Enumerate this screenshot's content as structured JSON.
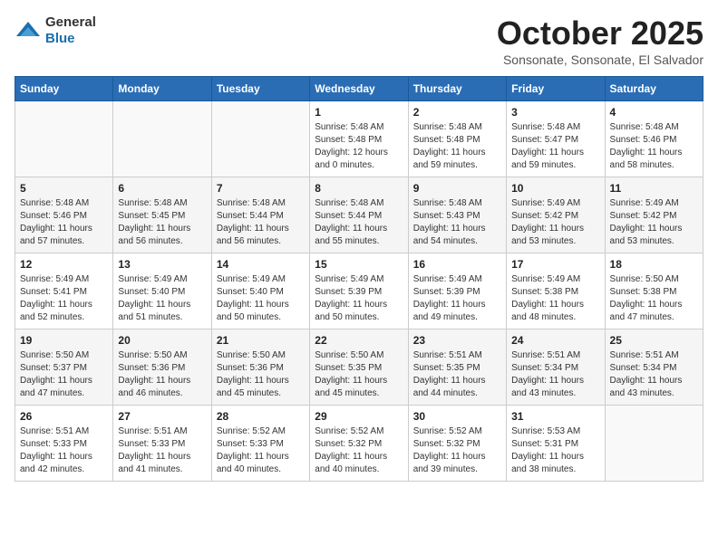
{
  "header": {
    "logo_general": "General",
    "logo_blue": "Blue",
    "month": "October 2025",
    "location": "Sonsonate, Sonsonate, El Salvador"
  },
  "days_of_week": [
    "Sunday",
    "Monday",
    "Tuesday",
    "Wednesday",
    "Thursday",
    "Friday",
    "Saturday"
  ],
  "weeks": [
    [
      {
        "day": "",
        "sunrise": "",
        "sunset": "",
        "daylight": ""
      },
      {
        "day": "",
        "sunrise": "",
        "sunset": "",
        "daylight": ""
      },
      {
        "day": "",
        "sunrise": "",
        "sunset": "",
        "daylight": ""
      },
      {
        "day": "1",
        "sunrise": "Sunrise: 5:48 AM",
        "sunset": "Sunset: 5:48 PM",
        "daylight": "Daylight: 12 hours and 0 minutes."
      },
      {
        "day": "2",
        "sunrise": "Sunrise: 5:48 AM",
        "sunset": "Sunset: 5:48 PM",
        "daylight": "Daylight: 11 hours and 59 minutes."
      },
      {
        "day": "3",
        "sunrise": "Sunrise: 5:48 AM",
        "sunset": "Sunset: 5:47 PM",
        "daylight": "Daylight: 11 hours and 59 minutes."
      },
      {
        "day": "4",
        "sunrise": "Sunrise: 5:48 AM",
        "sunset": "Sunset: 5:46 PM",
        "daylight": "Daylight: 11 hours and 58 minutes."
      }
    ],
    [
      {
        "day": "5",
        "sunrise": "Sunrise: 5:48 AM",
        "sunset": "Sunset: 5:46 PM",
        "daylight": "Daylight: 11 hours and 57 minutes."
      },
      {
        "day": "6",
        "sunrise": "Sunrise: 5:48 AM",
        "sunset": "Sunset: 5:45 PM",
        "daylight": "Daylight: 11 hours and 56 minutes."
      },
      {
        "day": "7",
        "sunrise": "Sunrise: 5:48 AM",
        "sunset": "Sunset: 5:44 PM",
        "daylight": "Daylight: 11 hours and 56 minutes."
      },
      {
        "day": "8",
        "sunrise": "Sunrise: 5:48 AM",
        "sunset": "Sunset: 5:44 PM",
        "daylight": "Daylight: 11 hours and 55 minutes."
      },
      {
        "day": "9",
        "sunrise": "Sunrise: 5:48 AM",
        "sunset": "Sunset: 5:43 PM",
        "daylight": "Daylight: 11 hours and 54 minutes."
      },
      {
        "day": "10",
        "sunrise": "Sunrise: 5:49 AM",
        "sunset": "Sunset: 5:42 PM",
        "daylight": "Daylight: 11 hours and 53 minutes."
      },
      {
        "day": "11",
        "sunrise": "Sunrise: 5:49 AM",
        "sunset": "Sunset: 5:42 PM",
        "daylight": "Daylight: 11 hours and 53 minutes."
      }
    ],
    [
      {
        "day": "12",
        "sunrise": "Sunrise: 5:49 AM",
        "sunset": "Sunset: 5:41 PM",
        "daylight": "Daylight: 11 hours and 52 minutes."
      },
      {
        "day": "13",
        "sunrise": "Sunrise: 5:49 AM",
        "sunset": "Sunset: 5:40 PM",
        "daylight": "Daylight: 11 hours and 51 minutes."
      },
      {
        "day": "14",
        "sunrise": "Sunrise: 5:49 AM",
        "sunset": "Sunset: 5:40 PM",
        "daylight": "Daylight: 11 hours and 50 minutes."
      },
      {
        "day": "15",
        "sunrise": "Sunrise: 5:49 AM",
        "sunset": "Sunset: 5:39 PM",
        "daylight": "Daylight: 11 hours and 50 minutes."
      },
      {
        "day": "16",
        "sunrise": "Sunrise: 5:49 AM",
        "sunset": "Sunset: 5:39 PM",
        "daylight": "Daylight: 11 hours and 49 minutes."
      },
      {
        "day": "17",
        "sunrise": "Sunrise: 5:49 AM",
        "sunset": "Sunset: 5:38 PM",
        "daylight": "Daylight: 11 hours and 48 minutes."
      },
      {
        "day": "18",
        "sunrise": "Sunrise: 5:50 AM",
        "sunset": "Sunset: 5:38 PM",
        "daylight": "Daylight: 11 hours and 47 minutes."
      }
    ],
    [
      {
        "day": "19",
        "sunrise": "Sunrise: 5:50 AM",
        "sunset": "Sunset: 5:37 PM",
        "daylight": "Daylight: 11 hours and 47 minutes."
      },
      {
        "day": "20",
        "sunrise": "Sunrise: 5:50 AM",
        "sunset": "Sunset: 5:36 PM",
        "daylight": "Daylight: 11 hours and 46 minutes."
      },
      {
        "day": "21",
        "sunrise": "Sunrise: 5:50 AM",
        "sunset": "Sunset: 5:36 PM",
        "daylight": "Daylight: 11 hours and 45 minutes."
      },
      {
        "day": "22",
        "sunrise": "Sunrise: 5:50 AM",
        "sunset": "Sunset: 5:35 PM",
        "daylight": "Daylight: 11 hours and 45 minutes."
      },
      {
        "day": "23",
        "sunrise": "Sunrise: 5:51 AM",
        "sunset": "Sunset: 5:35 PM",
        "daylight": "Daylight: 11 hours and 44 minutes."
      },
      {
        "day": "24",
        "sunrise": "Sunrise: 5:51 AM",
        "sunset": "Sunset: 5:34 PM",
        "daylight": "Daylight: 11 hours and 43 minutes."
      },
      {
        "day": "25",
        "sunrise": "Sunrise: 5:51 AM",
        "sunset": "Sunset: 5:34 PM",
        "daylight": "Daylight: 11 hours and 43 minutes."
      }
    ],
    [
      {
        "day": "26",
        "sunrise": "Sunrise: 5:51 AM",
        "sunset": "Sunset: 5:33 PM",
        "daylight": "Daylight: 11 hours and 42 minutes."
      },
      {
        "day": "27",
        "sunrise": "Sunrise: 5:51 AM",
        "sunset": "Sunset: 5:33 PM",
        "daylight": "Daylight: 11 hours and 41 minutes."
      },
      {
        "day": "28",
        "sunrise": "Sunrise: 5:52 AM",
        "sunset": "Sunset: 5:33 PM",
        "daylight": "Daylight: 11 hours and 40 minutes."
      },
      {
        "day": "29",
        "sunrise": "Sunrise: 5:52 AM",
        "sunset": "Sunset: 5:32 PM",
        "daylight": "Daylight: 11 hours and 40 minutes."
      },
      {
        "day": "30",
        "sunrise": "Sunrise: 5:52 AM",
        "sunset": "Sunset: 5:32 PM",
        "daylight": "Daylight: 11 hours and 39 minutes."
      },
      {
        "day": "31",
        "sunrise": "Sunrise: 5:53 AM",
        "sunset": "Sunset: 5:31 PM",
        "daylight": "Daylight: 11 hours and 38 minutes."
      },
      {
        "day": "",
        "sunrise": "",
        "sunset": "",
        "daylight": ""
      }
    ]
  ]
}
